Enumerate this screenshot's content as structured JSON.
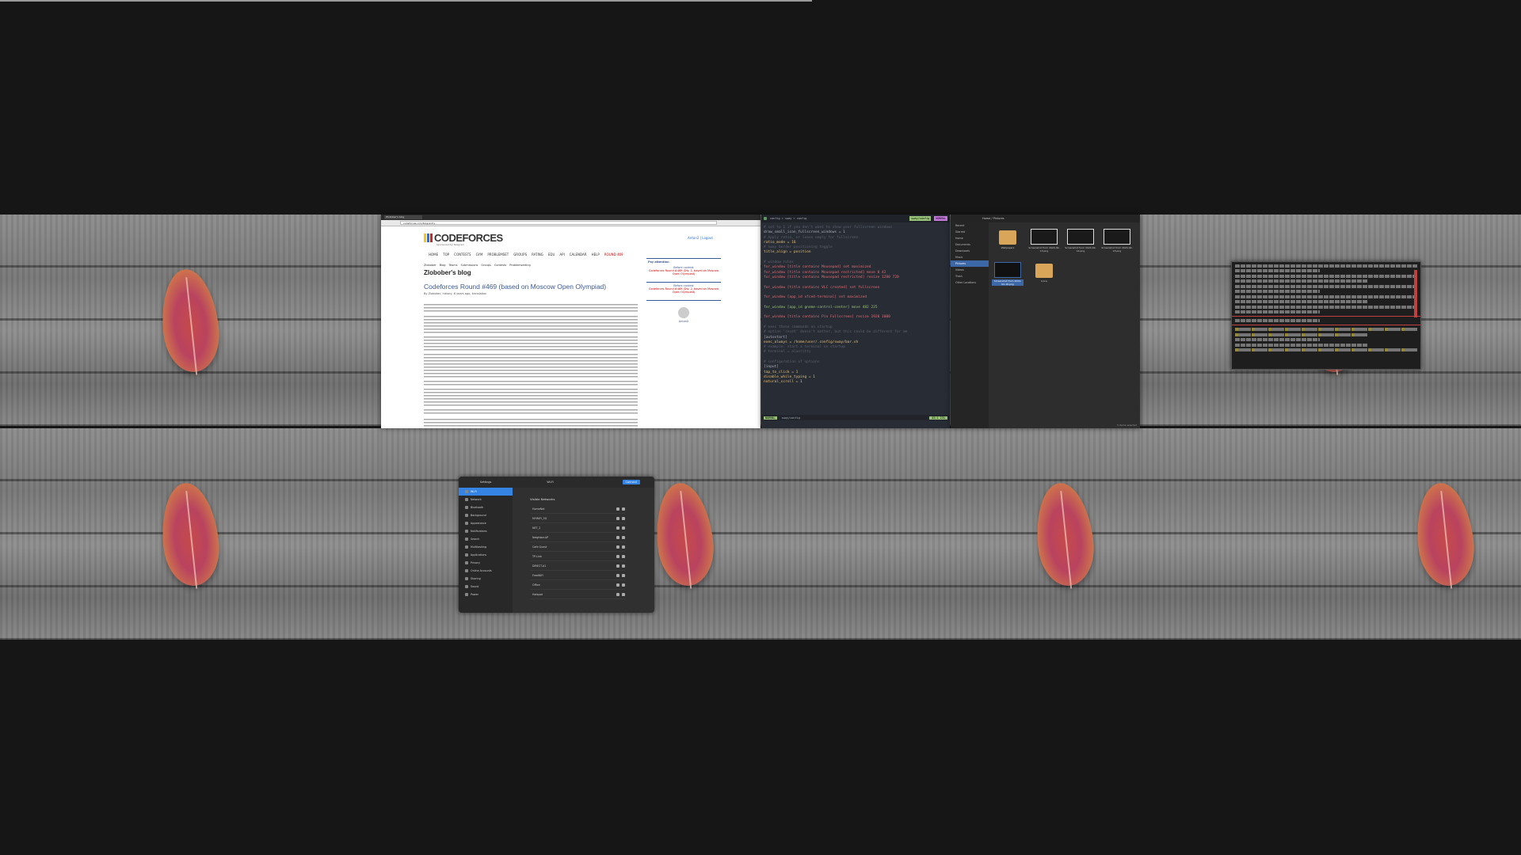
{
  "screen": {
    "background": "#161616"
  },
  "browser": {
    "tab_title": "Zlobober's blog",
    "url": "codeforces.com/blog/entry",
    "logo": "CODEFORCES",
    "logo_sub": "Sponsored by Telegram",
    "header_right": "Anton2 | Logout",
    "nav": [
      "HOME",
      "TOP",
      "CONTESTS",
      "GYM",
      "PROBLEMSET",
      "GROUPS",
      "RATING",
      "EDU",
      "API",
      "CALENDAR",
      "HELP"
    ],
    "nav_red": "ROUND 469",
    "subtabs": [
      "Zlobober",
      "Blog",
      "Teams",
      "Submissions",
      "Groups",
      "Contests",
      "Problemsetting"
    ],
    "blog_title": "Zlobober's blog",
    "post_title": "Codeforces Round #469 (based on Moscow Open Olympiad)",
    "post_by": "By Zlobober, history, 6 years ago, translation",
    "sidebar": {
      "pay_attention": "Pay attention",
      "before1": "Before contest",
      "contest1": "Codeforces Round #469 (Div. 1, based on Moscow Open Olympiad)",
      "before2": "Before contest",
      "contest2": "Codeforces Round #469 (Div. 2, based on Moscow Open Olympiad)",
      "user": "Anton2"
    }
  },
  "editor": {
    "breadcrumb": "config > sway > config",
    "mode_tag": "NORMAL",
    "file_tag": "sway/config",
    "lines": [
      {
        "text": "# set to 1 if you don't want to show your fullscreen windows",
        "cls": "c"
      },
      {
        "text": "draw_small_icon_fullscreen_windows = 1",
        "cls": ""
      },
      {
        "text": "# Apply ratio, or leave empty for fullscreen",
        "cls": "c"
      },
      {
        "text": "ratio_mode = 16",
        "cls": "y"
      },
      {
        "text": "# Sway border positioning toggle",
        "cls": "c"
      },
      {
        "text": "title_align = position",
        "cls": "y"
      },
      {
        "text": "",
        "cls": ""
      },
      {
        "text": "# window rules",
        "cls": "c"
      },
      {
        "text": "for_window [title contains Mousepad] set maximized",
        "cls": "k"
      },
      {
        "text": "for_window [title contains Mousepad restricted] move 0 42",
        "cls": "k"
      },
      {
        "text": "for_window [title contains Mousepad restricted] resize 1280 720",
        "cls": "k"
      },
      {
        "text": "",
        "cls": ""
      },
      {
        "text": "for_window [title contains VLC created] set fullscreen",
        "cls": "k"
      },
      {
        "text": "",
        "cls": ""
      },
      {
        "text": "for_window [app_id xfce4-terminal] set maximized",
        "cls": "k"
      },
      {
        "text": "",
        "cls": ""
      },
      {
        "text": "for_window [app_id gnome-control-center] move 482 225",
        "cls": "s"
      },
      {
        "text": "",
        "cls": ""
      },
      {
        "text": "for_window [title contains Pin Fullscreen] resize 1920 1080",
        "cls": "k"
      },
      {
        "text": "",
        "cls": ""
      },
      {
        "text": "# exec these commands on startup",
        "cls": "c"
      },
      {
        "text": "# option 'reset' doesn't matter, but this could be different for me",
        "cls": "c"
      },
      {
        "text": "[autostart]",
        "cls": ""
      },
      {
        "text": "exec_always = /home/user/.config/sway/bar.sh",
        "cls": "y"
      },
      {
        "text": "# example: start a terminal on startup",
        "cls": "c"
      },
      {
        "text": "# terminal = alacritty",
        "cls": "c"
      },
      {
        "text": "",
        "cls": ""
      },
      {
        "text": "# configuration of options",
        "cls": "c"
      },
      {
        "text": "[input]",
        "cls": ""
      },
      {
        "text": "tap_to_click = 1",
        "cls": "y"
      },
      {
        "text": "disable_while_typing = 1",
        "cls": "y"
      },
      {
        "text": "natural_scroll = 1",
        "cls": "y"
      }
    ],
    "status_mode": "NORMAL",
    "status_file": "sway/config",
    "status_pos": "43:1 23%"
  },
  "files": {
    "path": "Home / Pictures",
    "sidebar": [
      "Recent",
      "Starred",
      "Home",
      "Documents",
      "Downloads",
      "Music",
      "Pictures",
      "Videos",
      "Trash",
      "Other Locations"
    ],
    "selected_sidebar": "Pictures",
    "items": [
      {
        "label": "Wallpapers",
        "kind": "folder"
      },
      {
        "label": "Screenshot from 2024-02-13.png",
        "kind": "thumb"
      },
      {
        "label": "Screenshot from 2024-02-14.png",
        "kind": "thumb"
      },
      {
        "label": "Screenshot from 2024-02-15.png",
        "kind": "thumb"
      },
      {
        "label": "Screenshot from 2024-02-16.png",
        "kind": "thumb-blue"
      },
      {
        "label": "Icons",
        "kind": "folder"
      }
    ],
    "footer": "5 items selected"
  },
  "settings": {
    "title": "Settings",
    "page_title": "Wi-Fi",
    "button": "Connect",
    "sidebar": [
      "Wi-Fi",
      "Network",
      "Bluetooth",
      "Background",
      "Appearance",
      "Notifications",
      "Search",
      "Multitasking",
      "Applications",
      "Privacy",
      "Online Accounts",
      "Sharing",
      "Sound",
      "Power"
    ],
    "section_title": "Visible Networks",
    "networks": [
      "HomeNet",
      "MYWIFI_5G",
      "NET_2",
      "Neighbor-AP",
      "Cafe Guest",
      "TP-Link",
      "DIRECT-A1",
      "FreeWiFi",
      "Office",
      "Hotspot"
    ]
  }
}
